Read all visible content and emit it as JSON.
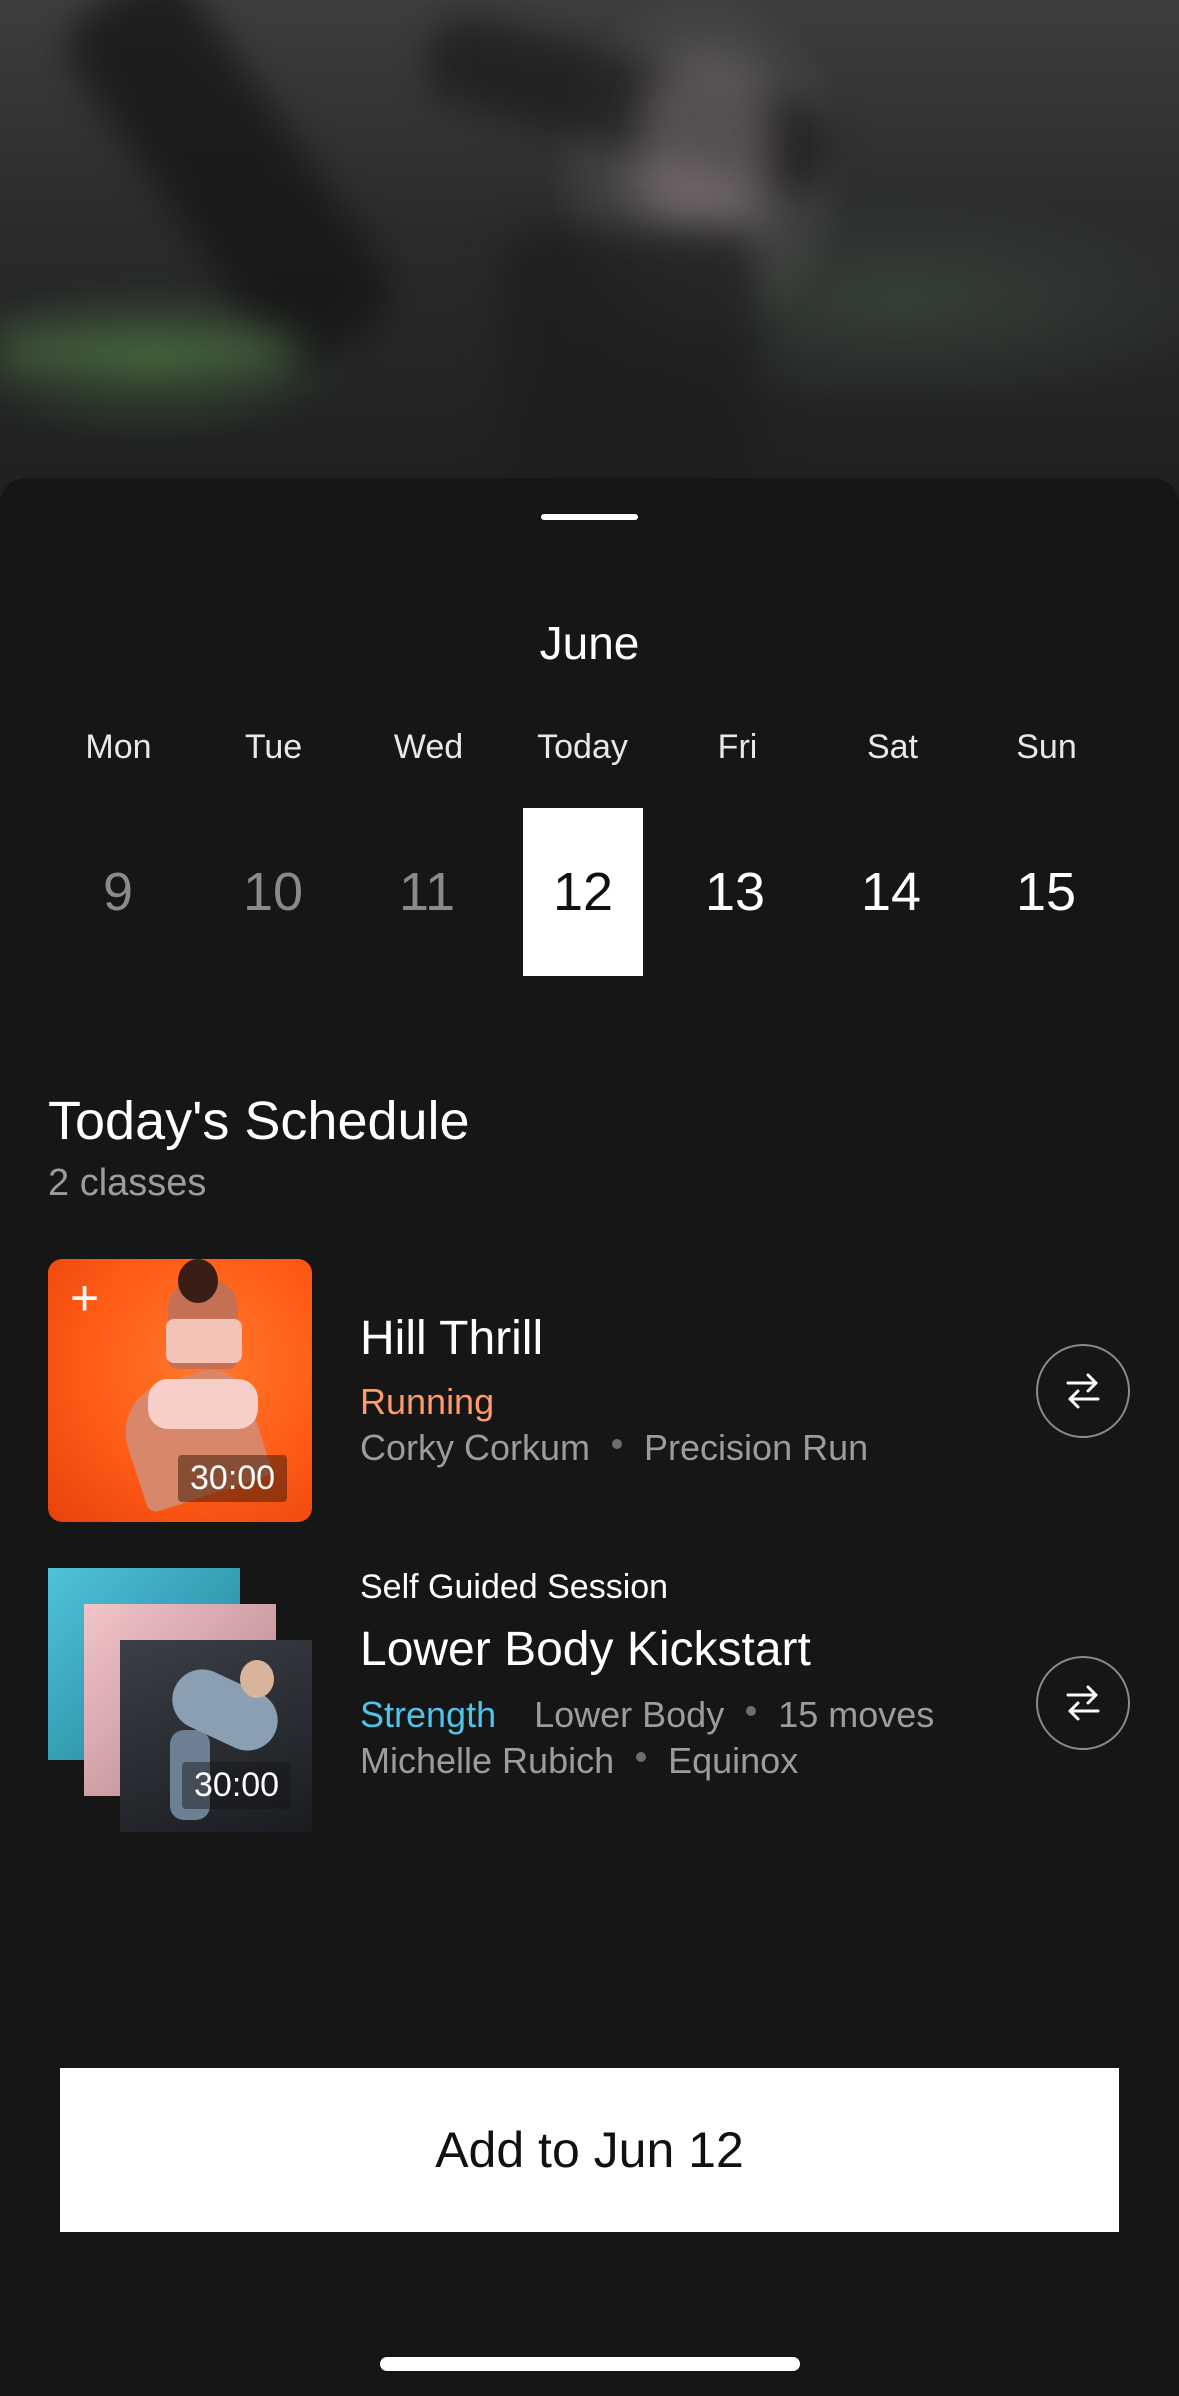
{
  "calendar": {
    "month": "June",
    "weekdays": [
      "Mon",
      "Tue",
      "Wed",
      "Today",
      "Fri",
      "Sat",
      "Sun"
    ],
    "dates": [
      "9",
      "10",
      "11",
      "12",
      "13",
      "14",
      "15"
    ]
  },
  "schedule": {
    "title": "Today's Schedule",
    "count": "2 classes",
    "classes": [
      {
        "title": "Hill Thrill",
        "category": "Running",
        "instructor": "Corky Corkum",
        "program": "Precision Run",
        "duration": "30:00"
      },
      {
        "eyebrow": "Self Guided Session",
        "title": "Lower Body Kickstart",
        "category": "Strength",
        "focus": "Lower Body",
        "moves": "15 moves",
        "instructor": "Michelle Rubich",
        "program": "Equinox",
        "duration": "30:00"
      }
    ]
  },
  "cta": {
    "label": "Add to Jun 12"
  },
  "colors": {
    "background": "#161617",
    "running": "#ff9a6a",
    "strength": "#4fc3e8",
    "muted": "#9c9c9e"
  },
  "icons": [
    "plus-icon",
    "swap-icon"
  ]
}
